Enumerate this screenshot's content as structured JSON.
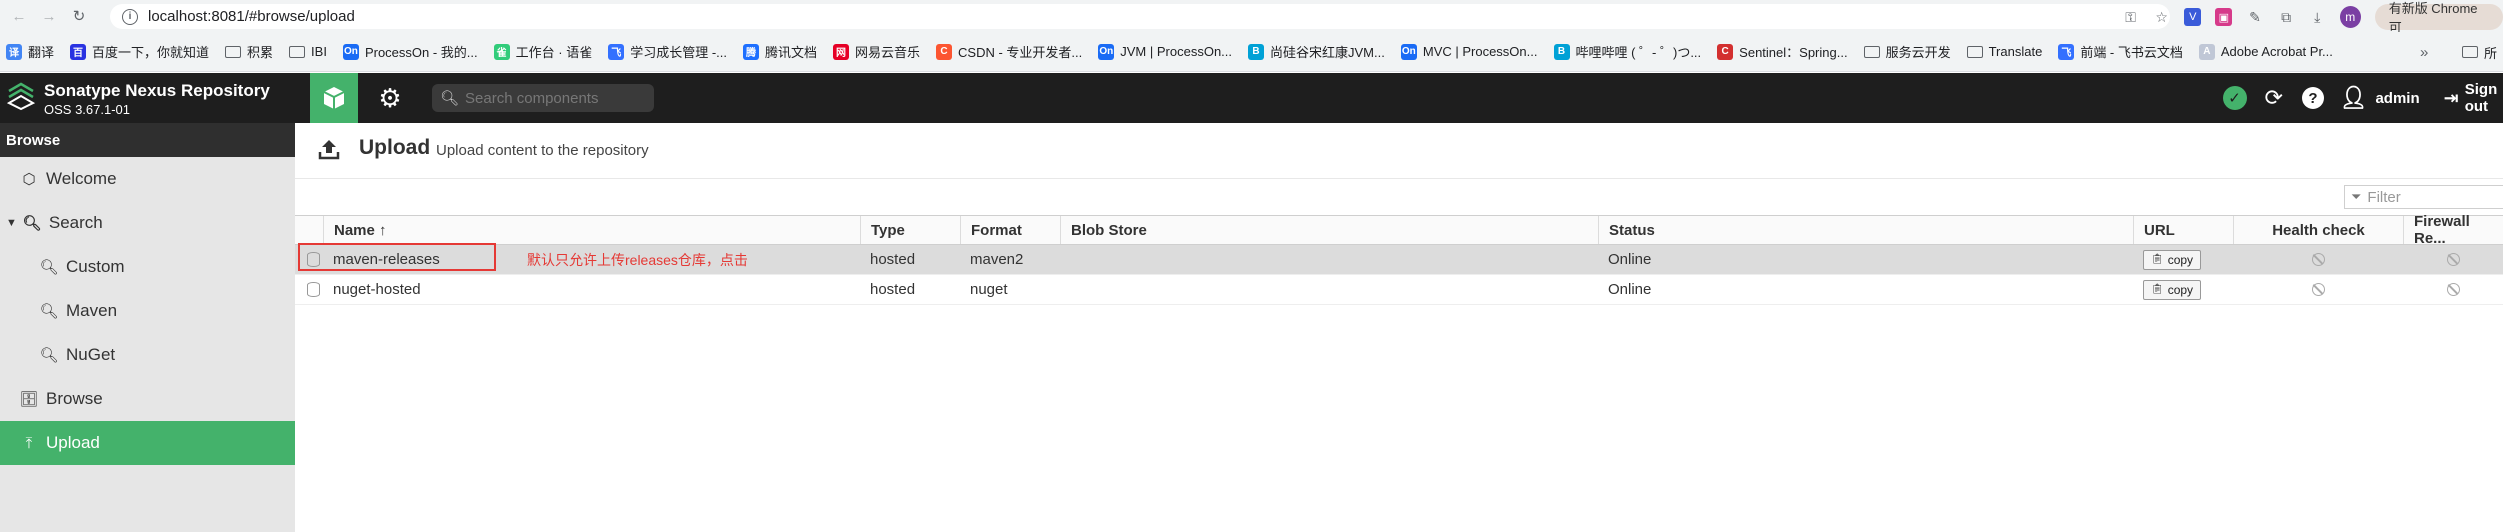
{
  "browser": {
    "url": "localhost:8081/#browse/upload",
    "new_chrome_label": "有新版 Chrome 可",
    "profile_letter": "m",
    "bookmarks": [
      {
        "label": "翻译",
        "color": "#4285f4",
        "glyph": "译"
      },
      {
        "label": "百度一下，你就知道",
        "color": "#2932e1",
        "glyph": "百"
      },
      {
        "label": "积累",
        "folder": true
      },
      {
        "label": "IBI",
        "folder": true
      },
      {
        "label": "ProcessOn - 我的...",
        "color": "#1a6bf5",
        "glyph": "On"
      },
      {
        "label": "工作台 · 语雀",
        "color": "#31cc7a",
        "glyph": "雀"
      },
      {
        "label": "学习成长管理 -...",
        "color": "#3370ff",
        "glyph": "飞"
      },
      {
        "label": "腾讯文档",
        "color": "#1e6fff",
        "glyph": "腾"
      },
      {
        "label": "网易云音乐",
        "color": "#e60026",
        "glyph": "网"
      },
      {
        "label": "CSDN - 专业开发者...",
        "color": "#fc5531",
        "glyph": "C"
      },
      {
        "label": "JVM | ProcessOn...",
        "color": "#1a6bf5",
        "glyph": "On"
      },
      {
        "label": "尚硅谷宋红康JVM...",
        "color": "#00a1d6",
        "glyph": "B"
      },
      {
        "label": "MVC | ProcessOn...",
        "color": "#1a6bf5",
        "glyph": "On"
      },
      {
        "label": "哔哩哔哩 ( ゜- ゜)つ...",
        "color": "#00a1d6",
        "glyph": "B"
      },
      {
        "label": "Sentinel：Spring...",
        "color": "#d32f2f",
        "glyph": "C"
      },
      {
        "label": "服务云开发",
        "folder": true
      },
      {
        "label": "Translate",
        "folder": true
      },
      {
        "label": "前端 - 飞书云文档",
        "color": "#3370ff",
        "glyph": "飞"
      },
      {
        "label": "Adobe Acrobat Pr...",
        "color": "#c0c7d6",
        "glyph": "A"
      }
    ],
    "bookmarks_all": "所"
  },
  "header": {
    "product_name": "Sonatype Nexus Repository",
    "version": "OSS 3.67.1-01",
    "search_placeholder": "Search components",
    "user": "admin",
    "sign_out": "Sign out"
  },
  "sidebar": {
    "heading": "Browse",
    "items": [
      {
        "label": "Welcome",
        "icon": "hexagon-icon"
      },
      {
        "label": "Search",
        "icon": "search-icon"
      },
      {
        "label": "Custom",
        "icon": "search-icon"
      },
      {
        "label": "Maven",
        "icon": "search-icon"
      },
      {
        "label": "NuGet",
        "icon": "search-icon"
      },
      {
        "label": "Browse",
        "icon": "database-icon"
      },
      {
        "label": "Upload",
        "icon": "upload-icon"
      }
    ]
  },
  "page": {
    "title": "Upload",
    "subtitle": "Upload content to the repository",
    "filter_placeholder": "Filter"
  },
  "table": {
    "columns": [
      "Name ↑",
      "Type",
      "Format",
      "Blob Store",
      "Status",
      "URL",
      "Health check",
      "Firewall Re..."
    ],
    "rows": [
      {
        "name": "maven-releases",
        "type": "hosted",
        "format": "maven2",
        "blob_store": "",
        "status": "Online",
        "url_button": "copy",
        "selected": true
      },
      {
        "name": "nuget-hosted",
        "type": "hosted",
        "format": "nuget",
        "blob_store": "",
        "status": "Online",
        "url_button": "copy",
        "selected": false
      }
    ]
  },
  "annotation": {
    "text": "默认只允许上传releases仓库，点击",
    "color": "#e53935"
  },
  "colors": {
    "brand_green": "#44b26b",
    "header_bg": "#1e1e1e"
  }
}
